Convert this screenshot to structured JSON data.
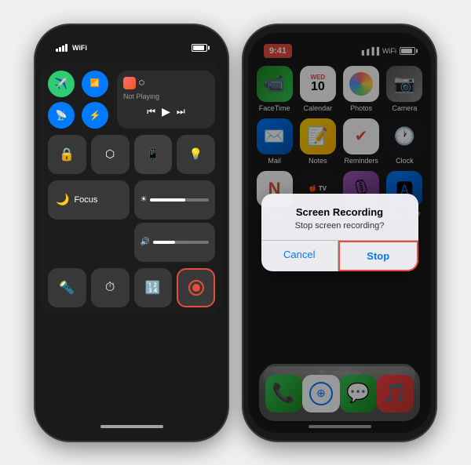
{
  "phones": {
    "left": {
      "status": {
        "battery": "100%"
      },
      "control_center": {
        "media": {
          "not_playing": "Not Playing"
        },
        "toggles": [
          "airplane",
          "cellular",
          "wifi",
          "bluetooth"
        ],
        "row2": [
          "screen_lock",
          "mirror",
          "brightness_down",
          "brightness_up"
        ],
        "focus": {
          "label": "Focus"
        },
        "row4": [
          "flashlight",
          "timer",
          "calculator",
          "camera"
        ]
      }
    },
    "right": {
      "status": {
        "time": "9:41"
      },
      "apps": [
        {
          "name": "FaceTime",
          "row": 1
        },
        {
          "name": "Calendar",
          "day": "WED",
          "date": "10",
          "row": 1
        },
        {
          "name": "Photos",
          "row": 1
        },
        {
          "name": "Camera",
          "row": 1
        },
        {
          "name": "Mail",
          "row": 2
        },
        {
          "name": "Notes",
          "row": 2
        },
        {
          "name": "Reminders",
          "row": 2
        },
        {
          "name": "Clock",
          "row": 2
        },
        {
          "name": "News",
          "row": 3
        },
        {
          "name": "TV",
          "row": 3
        },
        {
          "name": "Podcasts",
          "row": 3
        },
        {
          "name": "App Store",
          "row": 3
        }
      ],
      "dialog": {
        "title": "Screen Recording",
        "message": "Stop screen recording?",
        "cancel_label": "Cancel",
        "stop_label": "Stop"
      },
      "search": {
        "label": "Search"
      },
      "dock": [
        "Phone",
        "Safari",
        "Messages",
        "Music"
      ]
    }
  }
}
